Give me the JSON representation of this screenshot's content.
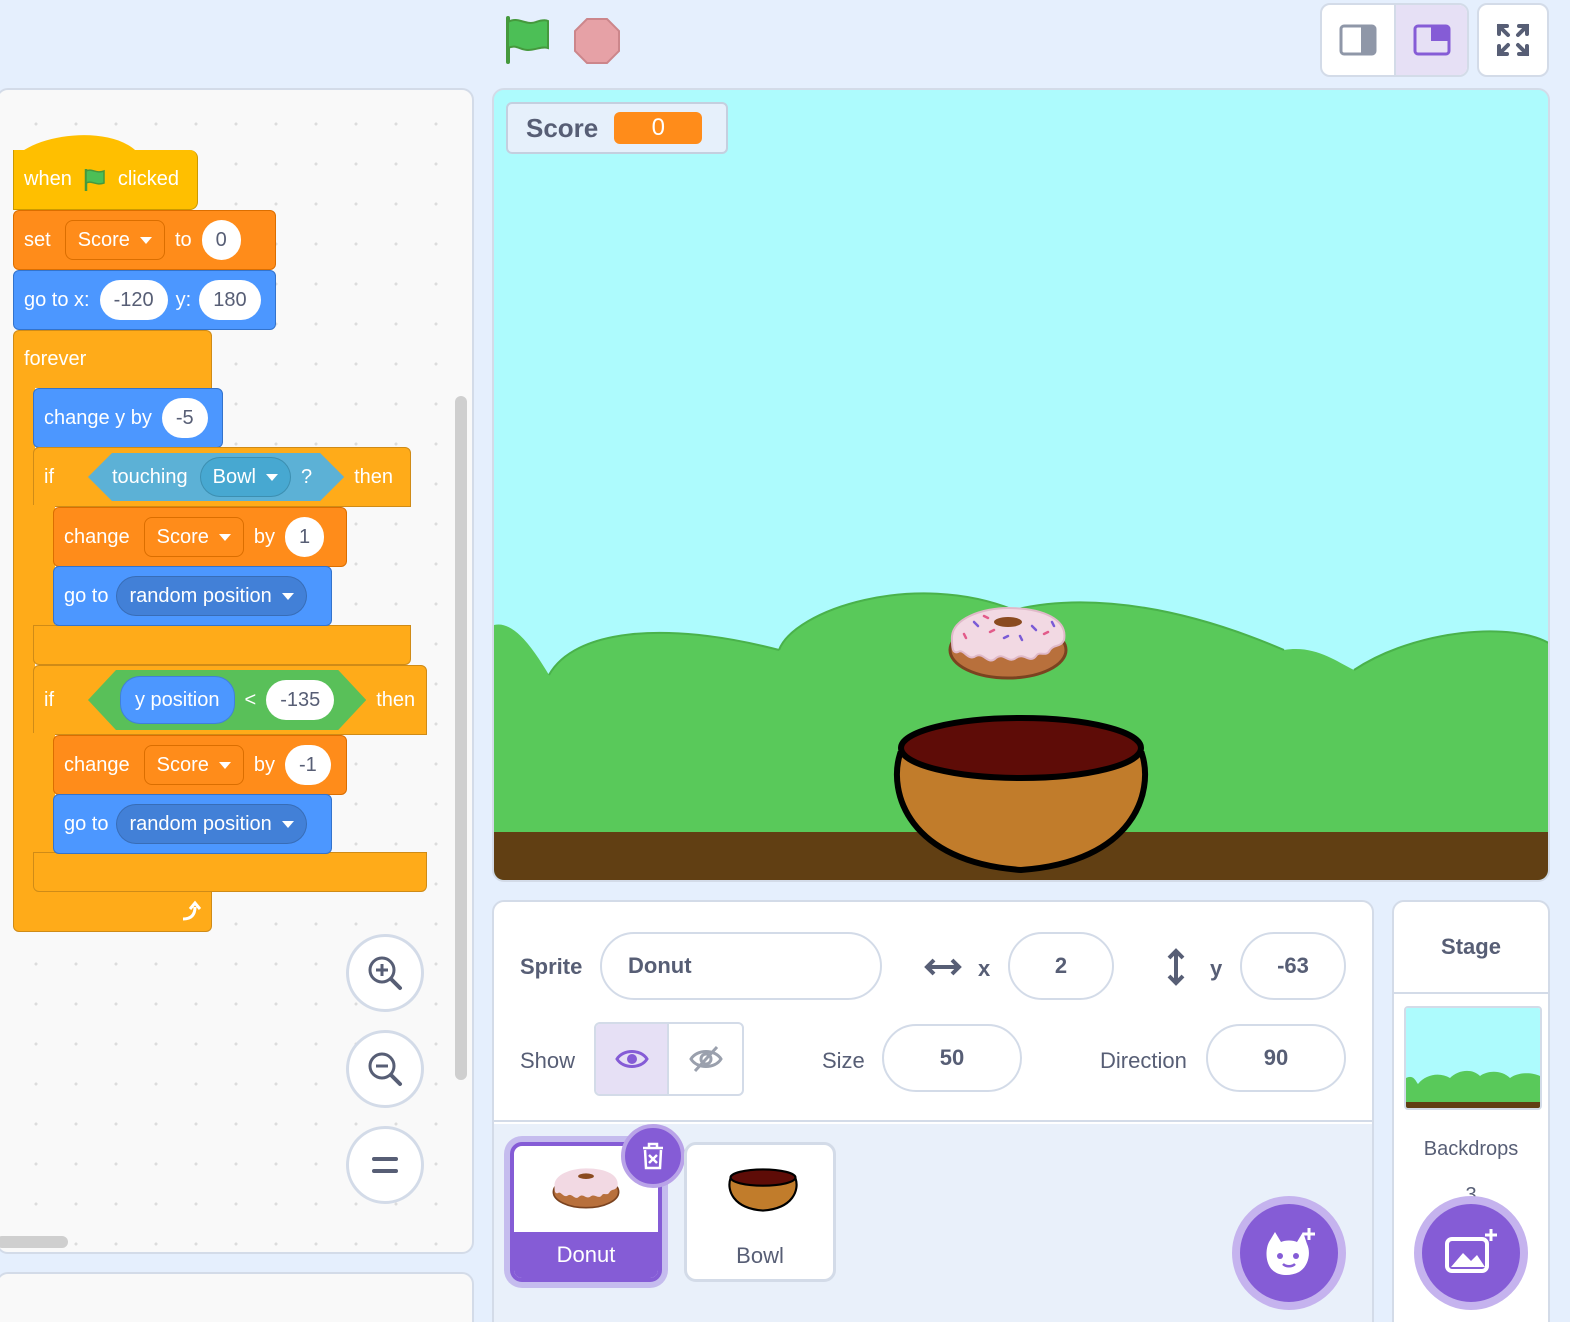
{
  "toolbar": {
    "green_flag_icon": "green-flag-icon",
    "stop_icon": "stop-sign-icon",
    "layout_small_icon": "small-stage-layout-icon",
    "layout_normal_icon": "normal-stage-layout-icon",
    "fullscreen_icon": "fullscreen-icon"
  },
  "script": {
    "hat": {
      "when": "when",
      "clicked": "clicked"
    },
    "set_var": {
      "verb": "set",
      "var": "Score",
      "to": "to",
      "value": "0"
    },
    "goto_xy": {
      "label": "go to x:",
      "x": "-120",
      "ylabel": "y:",
      "y": "180"
    },
    "forever": "forever",
    "change_y": {
      "label": "change y by",
      "value": "-5"
    },
    "if1": {
      "if": "if",
      "touching": "touching",
      "target": "Bowl",
      "q": "?",
      "then": "then"
    },
    "change_score1": {
      "verb": "change",
      "var": "Score",
      "by": "by",
      "value": "1"
    },
    "goto_random1": {
      "label": "go to",
      "target": "random position"
    },
    "if2": {
      "if": "if",
      "ypos": "y position",
      "op": "<",
      "value": "-135",
      "then": "then"
    },
    "change_score2": {
      "verb": "change",
      "var": "Score",
      "by": "by",
      "value": "-1"
    },
    "goto_random2": {
      "label": "go to",
      "target": "random position"
    }
  },
  "zoom": {
    "in_icon": "zoom-in-icon",
    "out_icon": "zoom-out-icon",
    "reset_icon": "zoom-reset-icon"
  },
  "stage": {
    "monitor_label": "Score",
    "monitor_value": "0"
  },
  "sprite_info": {
    "sprite_label": "Sprite",
    "sprite_name": "Donut",
    "x_label": "x",
    "x_value": "2",
    "y_label": "y",
    "y_value": "-63",
    "show_label": "Show",
    "size_label": "Size",
    "size_value": "50",
    "direction_label": "Direction",
    "direction_value": "90"
  },
  "sprites": [
    {
      "name": "Donut",
      "selected": true
    },
    {
      "name": "Bowl",
      "selected": false
    }
  ],
  "stage_pane": {
    "title": "Stage",
    "backdrops_label": "Backdrops",
    "backdrops_count": "3"
  },
  "colors": {
    "accent": "#855cd6",
    "events": "#ffbf00",
    "variables": "#ff8c1a",
    "motion": "#4c97ff",
    "control": "#ffab19",
    "operators": "#59c059",
    "sensing": "#5cb1d6"
  }
}
